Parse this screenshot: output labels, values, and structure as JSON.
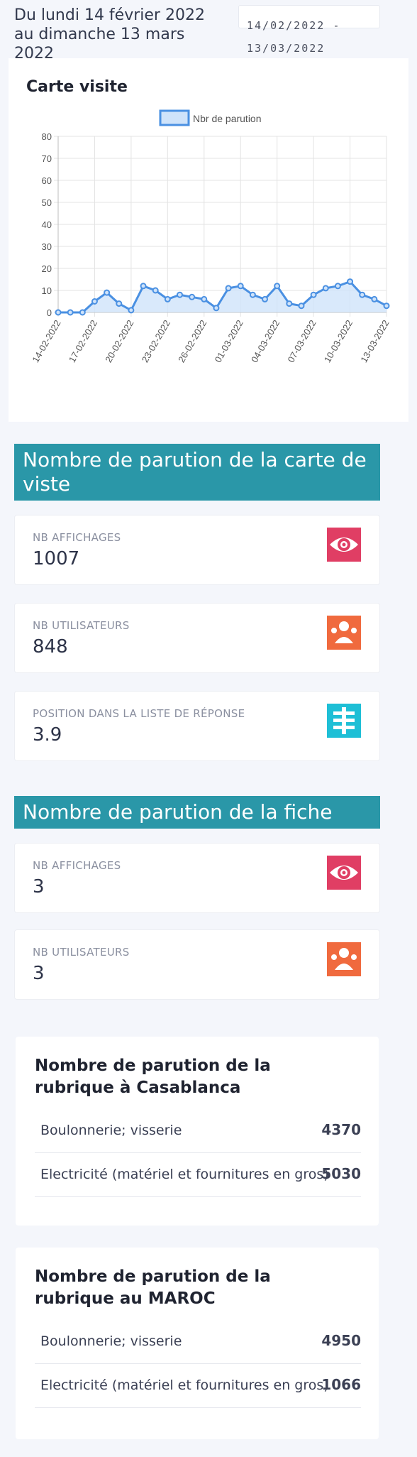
{
  "header": {
    "period": "Du lundi 14 février 2022 au dimanche 13 mars 2022",
    "date_range": "14/02/2022 - 13/03/2022"
  },
  "chart_card": {
    "title": "Carte visite"
  },
  "chart_data": {
    "type": "line",
    "x": [
      "14-02-2022",
      "15-02-2022",
      "16-02-2022",
      "17-02-2022",
      "18-02-2022",
      "19-02-2022",
      "20-02-2022",
      "21-02-2022",
      "22-02-2022",
      "23-02-2022",
      "24-02-2022",
      "25-02-2022",
      "26-02-2022",
      "27-02-2022",
      "28-02-2022",
      "01-03-2022",
      "02-03-2022",
      "03-03-2022",
      "04-03-2022",
      "05-03-2022",
      "06-03-2022",
      "07-03-2022",
      "08-03-2022",
      "09-03-2022",
      "10-03-2022",
      "11-03-2022",
      "12-03-2022",
      "13-03-2022"
    ],
    "tick_labels": [
      "14-02-2022",
      "17-02-2022",
      "20-02-2022",
      "23-02-2022",
      "26-02-2022",
      "01-03-2022",
      "04-03-2022",
      "07-03-2022",
      "10-03-2022",
      "13-03-2022"
    ],
    "series": [
      {
        "name": "Nbr de parution",
        "values": [
          0,
          0,
          0,
          5,
          9,
          4,
          1,
          12,
          10,
          6,
          8,
          7,
          6,
          2,
          11,
          12,
          8,
          6,
          12,
          4,
          3,
          8,
          11,
          12,
          14,
          8,
          6,
          3
        ]
      }
    ],
    "ylim": [
      0,
      80
    ],
    "yticks": [
      0,
      10,
      20,
      30,
      40,
      50,
      60,
      70,
      80
    ],
    "grid": true,
    "legend": "top",
    "title": "",
    "xlabel": "",
    "ylabel": "",
    "colors": {
      "line": "#4a90e2",
      "fill": "#cfe3fa",
      "grid": "#e3e3e3",
      "axis_text": "#555555"
    }
  },
  "section_carte": {
    "title": "Nombre de parution de la carte de viste",
    "stats": [
      {
        "label": "NB AFFICHAGES",
        "value": "1007",
        "icon": "eye-icon",
        "color": "#e03e64"
      },
      {
        "label": "NB UTILISATEURS",
        "value": "848",
        "icon": "users-icon",
        "color": "#f06a3e"
      },
      {
        "label": "POSITION DANS LA LISTE DE RÉPONSE",
        "value": "3.9",
        "icon": "list-position-icon",
        "color": "#1ebfd6"
      }
    ]
  },
  "section_fiche": {
    "title": "Nombre de parution de la fiche",
    "stats": [
      {
        "label": "NB AFFICHAGES",
        "value": "3",
        "icon": "eye-icon",
        "color": "#e03e64"
      },
      {
        "label": "NB UTILISATEURS",
        "value": "3",
        "icon": "users-icon",
        "color": "#f06a3e"
      }
    ]
  },
  "rubrique_casablanca": {
    "title": "Nombre de parution de la rubrique à Casablanca",
    "rows": [
      {
        "name": "Boulonnerie; visserie",
        "count": "4370"
      },
      {
        "name": "Electricité (matériel et fournitures en gros)",
        "count": "5030"
      }
    ]
  },
  "rubrique_maroc": {
    "title": "Nombre de parution de la rubrique au MAROC",
    "rows": [
      {
        "name": "Boulonnerie; visserie",
        "count": "4950"
      },
      {
        "name": "Electricité (matériel et fournitures en gros)",
        "count": "1066"
      }
    ]
  }
}
